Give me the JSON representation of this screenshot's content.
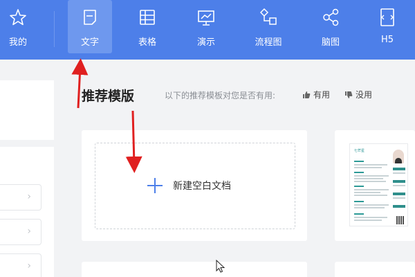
{
  "toolbar": {
    "items": [
      {
        "label": "我的",
        "icon": "star-icon"
      },
      {
        "label": "文字",
        "icon": "document-icon",
        "active": true
      },
      {
        "label": "表格",
        "icon": "table-icon"
      },
      {
        "label": "演示",
        "icon": "presentation-icon"
      },
      {
        "label": "流程图",
        "icon": "flowchart-icon"
      },
      {
        "label": "脑图",
        "icon": "mindmap-icon"
      },
      {
        "label": "H5",
        "icon": "h5-icon"
      }
    ],
    "accent": "#4d7fe9"
  },
  "main": {
    "section_title": "推荐模版",
    "feedback_prompt": "以下的推荐模板对您是否有用:",
    "useful_label": "有用",
    "useless_label": "没用",
    "new_blank_doc_label": "新建空白文档"
  },
  "template_preview": {
    "name": "七芒星"
  },
  "colors": {
    "annotation_arrow": "#e02020",
    "background": "#f2f3f5"
  }
}
